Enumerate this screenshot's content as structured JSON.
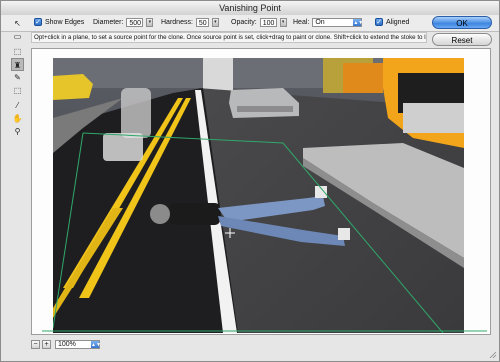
{
  "window": {
    "title": "Vanishing Point"
  },
  "options": {
    "show_edges_label": "Show Edges",
    "show_edges_checked": true,
    "diameter_label": "Diameter:",
    "diameter_value": "500",
    "hardness_label": "Hardness:",
    "hardness_value": "50",
    "opacity_label": "Opacity:",
    "opacity_value": "100",
    "heal_label": "Heal:",
    "heal_value": "On",
    "aligned_label": "Aligned",
    "aligned_checked": true
  },
  "buttons": {
    "ok": "OK",
    "reset": "Reset"
  },
  "hint": "Opt+click in a plane, to set a source point for the clone. Once source point is set, click+drag to paint or clone. Shift+click to extend the stoke to last click.",
  "tools": [
    {
      "name": "edit-plane-tool",
      "glyph": "↖"
    },
    {
      "name": "create-plane-tool",
      "glyph": "▭"
    },
    {
      "name": "marquee-tool",
      "glyph": "⬚"
    },
    {
      "name": "stamp-tool",
      "glyph": "♜"
    },
    {
      "name": "brush-tool",
      "glyph": "✎"
    },
    {
      "name": "transform-tool",
      "glyph": "⬚"
    },
    {
      "name": "eyedropper-tool",
      "glyph": "⁄"
    },
    {
      "name": "hand-tool",
      "glyph": "✋"
    },
    {
      "name": "zoom-tool",
      "glyph": "⚲"
    }
  ],
  "status": {
    "zoom_value": "100%",
    "zoom_out_glyph": "−",
    "zoom_in_glyph": "+"
  },
  "colors": {
    "accent": "#3f86e0",
    "plane_grid": "#2fa86a"
  }
}
